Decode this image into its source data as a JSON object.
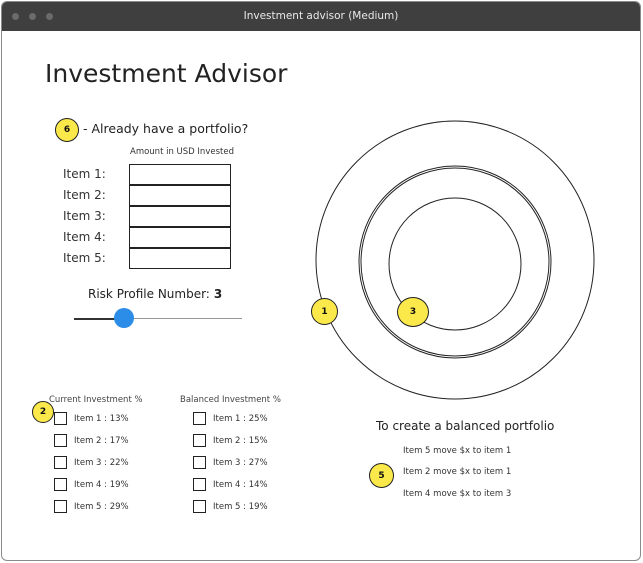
{
  "window": {
    "title": "Investment advisor (Medium)"
  },
  "app_title": "Investment Advisor",
  "portfolio": {
    "badge": "6",
    "question": "- Already have a portfolio?",
    "amount_header": "Amount in USD Invested",
    "items": [
      {
        "label": "Item 1:",
        "value": ""
      },
      {
        "label": "Item 2:",
        "value": ""
      },
      {
        "label": "Item 3:",
        "value": ""
      },
      {
        "label": "Item 4:",
        "value": ""
      },
      {
        "label": "Item 5:",
        "value": ""
      }
    ]
  },
  "risk": {
    "label": "Risk Profile Number:",
    "value": "3",
    "slider_fraction": 0.3
  },
  "current": {
    "badge": "2",
    "header": "Current Investment %",
    "items": [
      "Item 1 : 13%",
      "Item 2 : 17%",
      "Item 3 : 22%",
      "Item 4 : 19%",
      "Item 5 : 29%"
    ]
  },
  "balanced": {
    "header": "Balanced Investment %",
    "items": [
      "Item 1 : 25%",
      "Item 2 : 15%",
      "Item 3 : 27%",
      "Item 4 : 14%",
      "Item 5 : 19%"
    ]
  },
  "chart": {
    "outer_badge": "1",
    "inner_badge": "3"
  },
  "rebalance": {
    "title": "To create a balanced portfolio",
    "badge": "5",
    "instructions": [
      "Item 5 move $x to item 1",
      "Item 2 move $x to item 1",
      "Item 4 move $x to item 3"
    ]
  },
  "colors": {
    "badge": "#fbe84a",
    "slider_thumb": "#2b8de8",
    "titlebar": "#3f3f3f"
  }
}
